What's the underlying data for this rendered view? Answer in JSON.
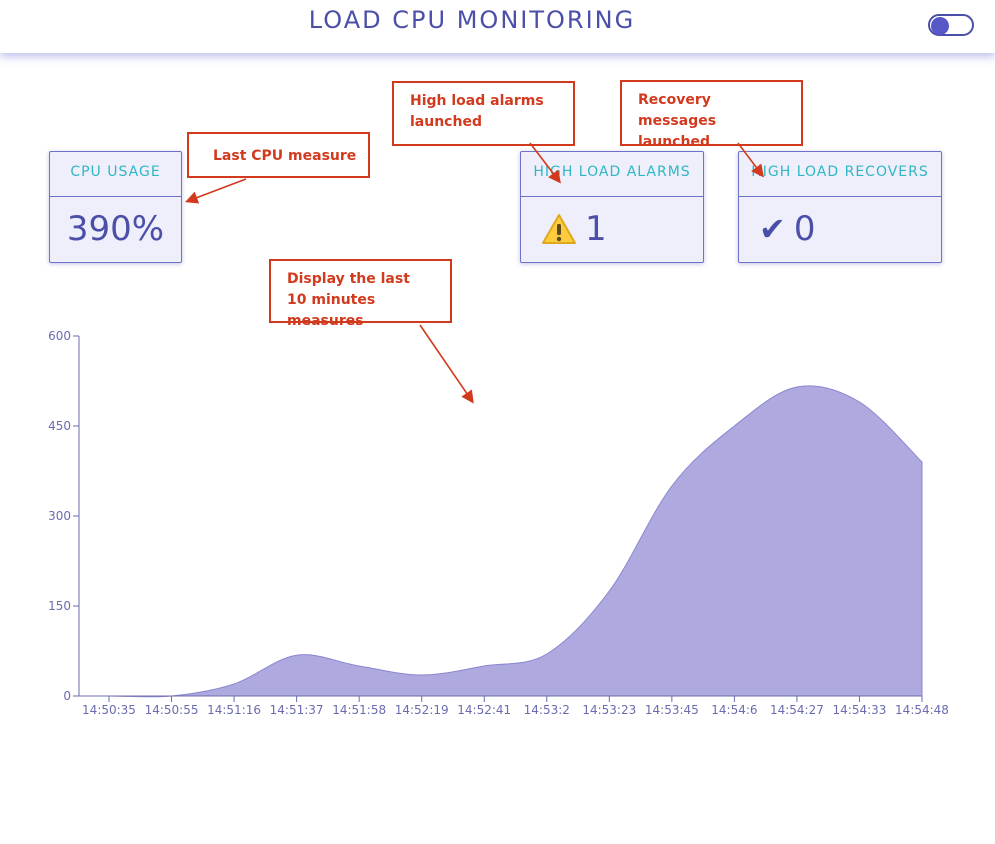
{
  "header": {
    "title": "LOAD CPU MONITORING",
    "dark_mode_toggle": {
      "on": false
    }
  },
  "cards": {
    "cpu_usage": {
      "label": "CPU USAGE",
      "value": "390%"
    },
    "alarms": {
      "label": "HIGH LOAD ALARMS",
      "value": "1",
      "icon": "warning-icon"
    },
    "recovers": {
      "label": "HIGH LOAD RECOVERS",
      "value": "0",
      "icon": "checkmark-icon"
    }
  },
  "annotations": {
    "last_cpu": "Last CPU measure",
    "alarms": "High load alarms\nlaunched",
    "recovery": "Recovery messages\nlaunched",
    "chart": "Display the last\n10 minutes measures"
  },
  "colors": {
    "primary": "#4b4fa8",
    "accent_teal": "#2fb7c4",
    "area_fill": "#aeaae0",
    "annotation_red": "#d23a1e",
    "card_bg": "#efeffb"
  },
  "chart_data": {
    "type": "area",
    "x": [
      "14:50:35",
      "14:50:55",
      "14:51:16",
      "14:51:37",
      "14:51:58",
      "14:52:19",
      "14:52:41",
      "14:53:2",
      "14:53:23",
      "14:53:45",
      "14:54:6",
      "14:54:27",
      "14:54:33",
      "14:54:48"
    ],
    "values": [
      0,
      0,
      20,
      68,
      50,
      35,
      50,
      70,
      175,
      350,
      450,
      515,
      490,
      390
    ],
    "yticks": [
      0,
      150,
      300,
      450,
      600
    ],
    "ylim": [
      0,
      600
    ],
    "title": "",
    "xlabel": "",
    "ylabel": "",
    "grid": false,
    "legend": "none"
  }
}
